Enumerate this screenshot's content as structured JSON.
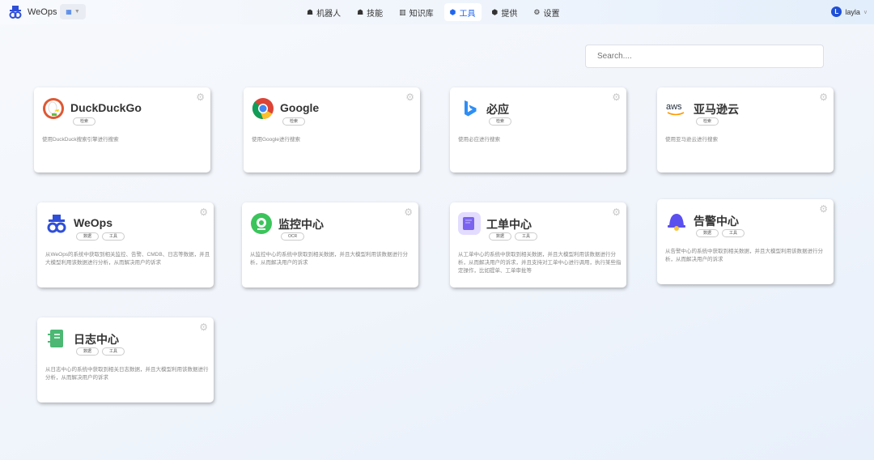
{
  "header": {
    "brand": "WeOps",
    "app_switcher_icon": "grid-icon",
    "nav": [
      {
        "label": "机器人",
        "icon": "robot-icon",
        "active": false
      },
      {
        "label": "技能",
        "icon": "skill-icon",
        "active": false
      },
      {
        "label": "知识库",
        "icon": "library-icon",
        "active": false
      },
      {
        "label": "工具",
        "icon": "tool-icon",
        "active": true
      },
      {
        "label": "提供",
        "icon": "provider-icon",
        "active": false
      },
      {
        "label": "设置",
        "icon": "gear-icon",
        "active": false
      }
    ],
    "user": {
      "initial": "L",
      "name": "layla"
    }
  },
  "search": {
    "placeholder": "Search....",
    "value": ""
  },
  "accent": "#1f66f0",
  "tools": [
    {
      "title": "DuckDuckGo",
      "icon": "duckduckgo-logo",
      "tags": [
        "检索"
      ],
      "desc": "使用DuckDuck搜索引擎进行搜索"
    },
    {
      "title": "Google",
      "icon": "chrome-logo",
      "tags": [
        "检索"
      ],
      "desc": "使用Google进行搜索"
    },
    {
      "title": "必应",
      "icon": "bing-logo",
      "tags": [
        "检索"
      ],
      "desc": "使用必应进行搜索"
    },
    {
      "title": "亚马逊云",
      "icon": "aws-logo",
      "tags": [
        "检索"
      ],
      "desc": "使用亚马逊云进行搜索"
    },
    {
      "title": "WeOps",
      "icon": "weops-logo",
      "tags": [
        "数据",
        "工具"
      ],
      "desc": "从WeOps的系统中获取到相关监控、告警、CMDB、日志等数据，并且大模型利用该数据进行分析，从而解决用户的诉求"
    },
    {
      "title": "监控中心",
      "icon": "monitor-icon",
      "tags": [
        "OCR"
      ],
      "desc": "从监控中心的系统中获取到相关数据，并且大模型利用该数据进行分析，从而解决用户的诉求"
    },
    {
      "title": "工单中心",
      "icon": "ticket-icon",
      "tags": [
        "数据",
        "工具"
      ],
      "desc": "从工单中心的系统中获取到相关数据，并且大模型利用该数据进行分析，从而解决用户的诉求，并且支持对工单中心进行调用，执行某些指定操作，比如提单、工单审批等"
    },
    {
      "title": "告警中心",
      "icon": "bell-icon",
      "tags": [
        "数据",
        "工具"
      ],
      "desc": "从告警中心的系统中获取到相关数据，并且大模型利用该数据进行分析，从而解决用户的诉求"
    },
    {
      "title": "日志中心",
      "icon": "log-icon",
      "tags": [
        "数据",
        "工具"
      ],
      "desc": "从日志中心的系统中获取到相关日志数据，并且大模型利用该数据进行分析，从而解决用户的诉求"
    }
  ]
}
